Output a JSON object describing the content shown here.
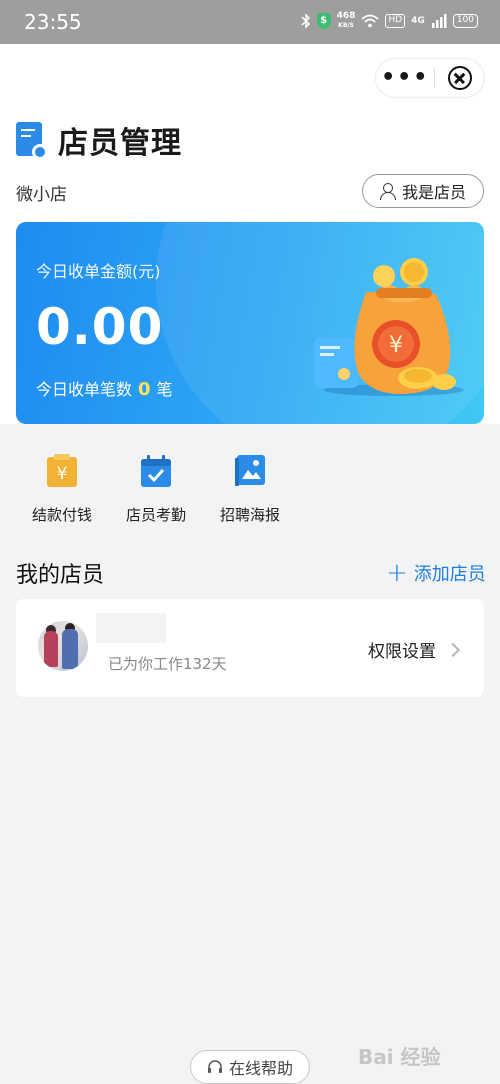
{
  "status_bar": {
    "time": "23:55",
    "net_speed_value": "468",
    "net_speed_unit": "KB/S",
    "hd_badge": "HD",
    "network": "4G",
    "battery": "100"
  },
  "nav": {
    "more_icon": "more-dots-icon",
    "close_icon": "close-circle-icon"
  },
  "page": {
    "title": "店员管理",
    "shop_name": "微小店",
    "role_button": "我是店员"
  },
  "summary_card": {
    "amount_label": "今日收单金额(元)",
    "amount": "0.00",
    "count_prefix": "今日收单笔数",
    "count": "0",
    "count_suffix": "笔"
  },
  "quick_actions": [
    {
      "label": "结款付钱",
      "icon": "yuan-receipt-icon"
    },
    {
      "label": "店员考勤",
      "icon": "calendar-check-icon"
    },
    {
      "label": "招聘海报",
      "icon": "poster-icon"
    }
  ],
  "staff_section": {
    "title": "我的店员",
    "add_label": "添加店员",
    "staff": [
      {
        "name": "",
        "work_days_text": "已为你工作132天",
        "action": "权限设置"
      }
    ]
  },
  "footer": {
    "help_label": "在线帮助"
  },
  "watermark": {
    "text": "Bai 经验"
  },
  "colors": {
    "accent": "#1e7fe0",
    "card_start": "#1e8cf0",
    "card_end": "#41c8f4",
    "count_highlight": "#ffe45c"
  }
}
